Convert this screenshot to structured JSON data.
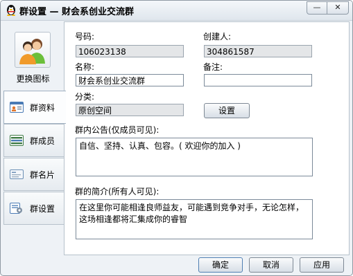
{
  "window": {
    "title": "群设置 — 财会系创业交流群",
    "minimize_glyph": "—",
    "close_glyph": "✕"
  },
  "sidebar": {
    "change_icon_label": "更换图标",
    "items": [
      {
        "label": "群资料",
        "icon": "group-profile-icon",
        "active": true
      },
      {
        "label": "群成员",
        "icon": "group-members-icon",
        "active": false
      },
      {
        "label": "群名片",
        "icon": "group-card-icon",
        "active": false
      },
      {
        "label": "群设置",
        "icon": "group-settings-icon",
        "active": false
      }
    ]
  },
  "form": {
    "number_label": "号码:",
    "number_value": "106023138",
    "creator_label": "创建人:",
    "creator_value": "304861587",
    "name_label": "名称:",
    "name_value": "财会系创业交流群",
    "note_label": "备注:",
    "note_value": "",
    "category_label": "分类:",
    "category_value": "原创空间",
    "settings_button": "设置",
    "announcement_label": "群内公告(仅成员可见):",
    "announcement_text": "自信、坚持、认真、包容。( 欢迎你的加入 )",
    "intro_label": "群的简介(所有人可见):",
    "intro_text": "在这里你可能相逢良师益友，可能遇到竞争对手，无论怎样，这场相逢都将汇集成你的睿智"
  },
  "footer": {
    "ok_label": "确定",
    "cancel_label": "取消",
    "apply_label": "应用"
  },
  "colors": {
    "window_bg": "#eef2f6",
    "content_bg": "#ffffff",
    "readonly_field_bg": "#e4e6e8"
  }
}
